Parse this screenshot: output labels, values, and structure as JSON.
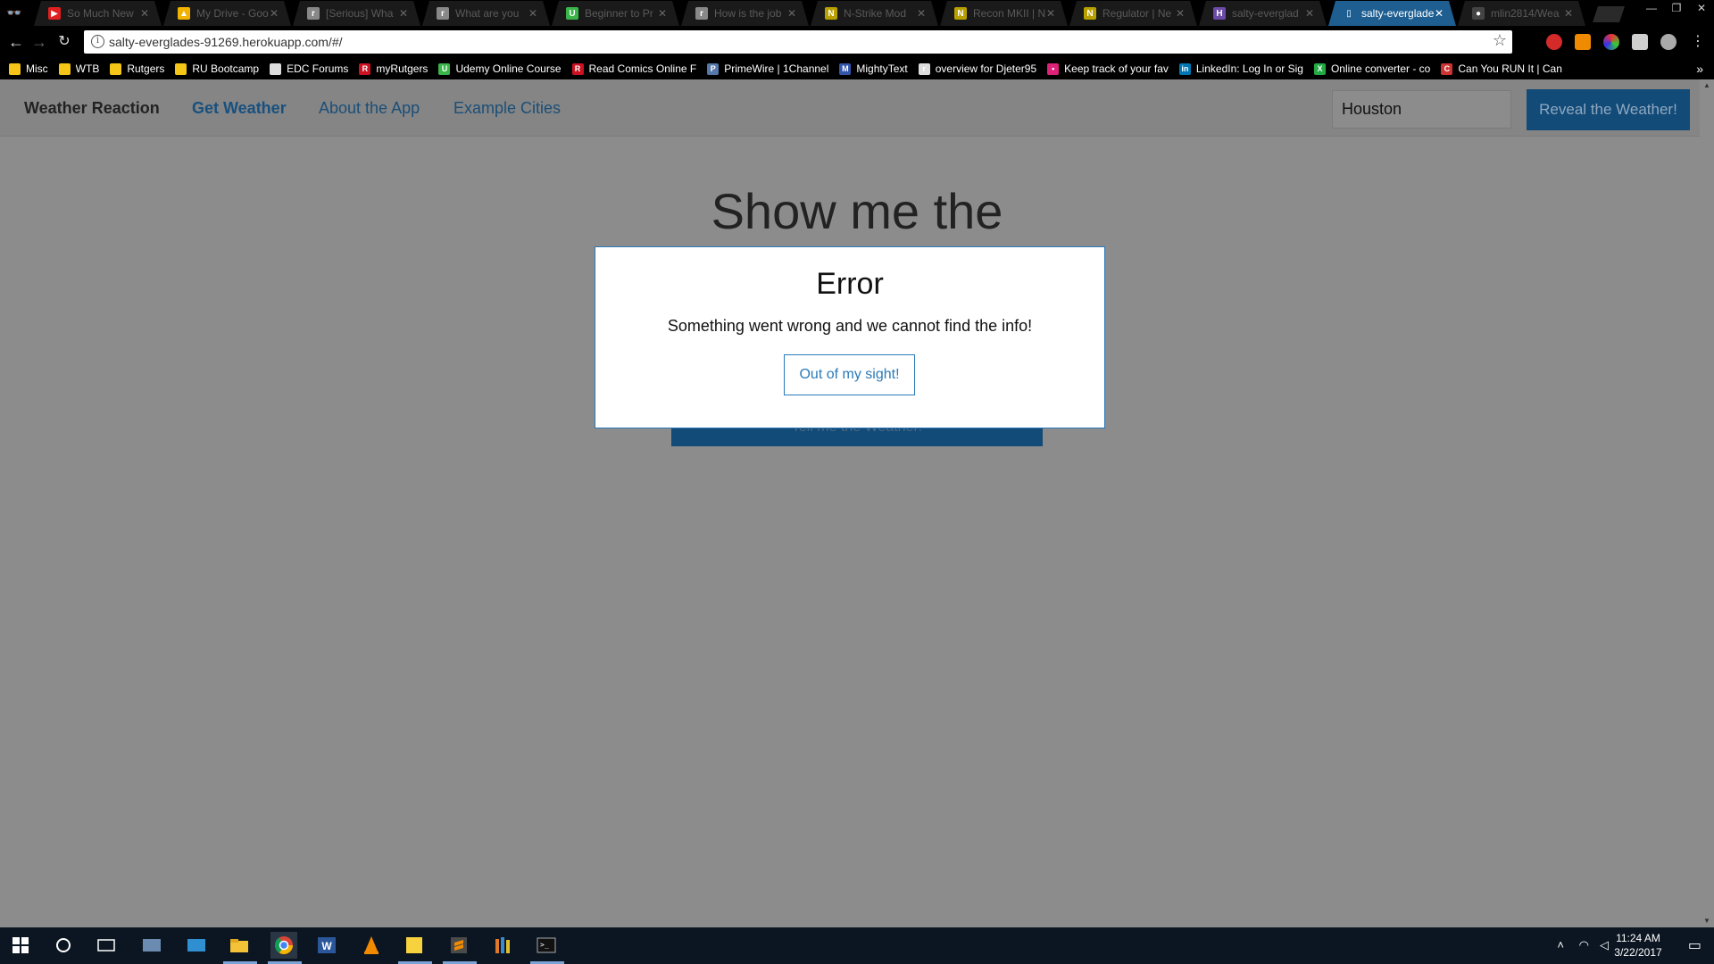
{
  "browser": {
    "tabs": [
      {
        "label": "So Much New",
        "icon_color": "#e02020",
        "icon_glyph": "▶",
        "active": false
      },
      {
        "label": "My Drive - Goo",
        "icon_color": "#f2b200",
        "icon_glyph": "▲",
        "active": false
      },
      {
        "label": "[Serious] Wha",
        "icon_color": "#888888",
        "icon_glyph": "r",
        "active": false
      },
      {
        "label": "What are you",
        "icon_color": "#888888",
        "icon_glyph": "r",
        "active": false
      },
      {
        "label": "Beginner to Pr",
        "icon_color": "#3ab54a",
        "icon_glyph": "U",
        "active": false
      },
      {
        "label": "How is the job",
        "icon_color": "#888888",
        "icon_glyph": "r",
        "active": false
      },
      {
        "label": "N-Strike Mod",
        "icon_color": "#b8a000",
        "icon_glyph": "N",
        "active": false
      },
      {
        "label": "Recon MKII | N",
        "icon_color": "#b8a000",
        "icon_glyph": "N",
        "active": false
      },
      {
        "label": "Regulator | Ne",
        "icon_color": "#b8a000",
        "icon_glyph": "N",
        "active": false
      },
      {
        "label": "salty-everglad",
        "icon_color": "#6b4aa8",
        "icon_glyph": "H",
        "active": false
      },
      {
        "label": "salty-everglade",
        "icon_color": "#1e5e91",
        "icon_glyph": "▯",
        "active": true
      },
      {
        "label": "mlin2814/Wea",
        "icon_color": "#444444",
        "icon_glyph": "●",
        "active": false
      }
    ],
    "url": "salty-everglades-91269.herokuapp.com/#/",
    "bookmarks": [
      {
        "label": "Misc",
        "icon_color": "#f5c518",
        "icon_glyph": ""
      },
      {
        "label": "WTB",
        "icon_color": "#f5c518",
        "icon_glyph": ""
      },
      {
        "label": "Rutgers",
        "icon_color": "#f5c518",
        "icon_glyph": ""
      },
      {
        "label": "RU Bootcamp",
        "icon_color": "#f5c518",
        "icon_glyph": ""
      },
      {
        "label": "EDC Forums",
        "icon_color": "#dddddd",
        "icon_glyph": ""
      },
      {
        "label": "myRutgers",
        "icon_color": "#cc1122",
        "icon_glyph": "R"
      },
      {
        "label": "Udemy Online Course",
        "icon_color": "#3ab54a",
        "icon_glyph": "U"
      },
      {
        "label": "Read Comics Online F",
        "icon_color": "#cc1122",
        "icon_glyph": "R"
      },
      {
        "label": "PrimeWire | 1Channel",
        "icon_color": "#5577aa",
        "icon_glyph": "P"
      },
      {
        "label": "MightyText",
        "icon_color": "#3355aa",
        "icon_glyph": "M"
      },
      {
        "label": "overview for Djeter95",
        "icon_color": "#dddddd",
        "icon_glyph": "r"
      },
      {
        "label": "Keep track of your fav",
        "icon_color": "#dd2277",
        "icon_glyph": "•"
      },
      {
        "label": "LinkedIn: Log In or Sig",
        "icon_color": "#0077b5",
        "icon_glyph": "in"
      },
      {
        "label": "Online converter - co",
        "icon_color": "#22aa44",
        "icon_glyph": "X"
      },
      {
        "label": "Can You RUN It | Can",
        "icon_color": "#cc3333",
        "icon_glyph": "C"
      }
    ]
  },
  "nav": {
    "brand": "Weather Reaction",
    "links": [
      "Get Weather",
      "About the App",
      "Example Cities"
    ],
    "city_value": "Houston",
    "reveal_label": "Reveal the Weather!"
  },
  "main": {
    "hero_text": "Show me the",
    "hidden_button_label": "Tell me the Weather!"
  },
  "modal": {
    "title": "Error",
    "message": "Something went wrong and we cannot find the info!",
    "button_label": "Out of my sight!"
  },
  "taskbar": {
    "time": "11:24 AM",
    "date": "3/22/2017",
    "pinned": [
      "windows-start-icon",
      "cortana-icon",
      "task-view-icon",
      "app-icon",
      "app-icon",
      "file-explorer-icon",
      "chrome-icon",
      "word-icon",
      "vlc-icon",
      "sticky-notes-icon",
      "sublime-icon",
      "library-icon",
      "terminal-icon"
    ]
  }
}
